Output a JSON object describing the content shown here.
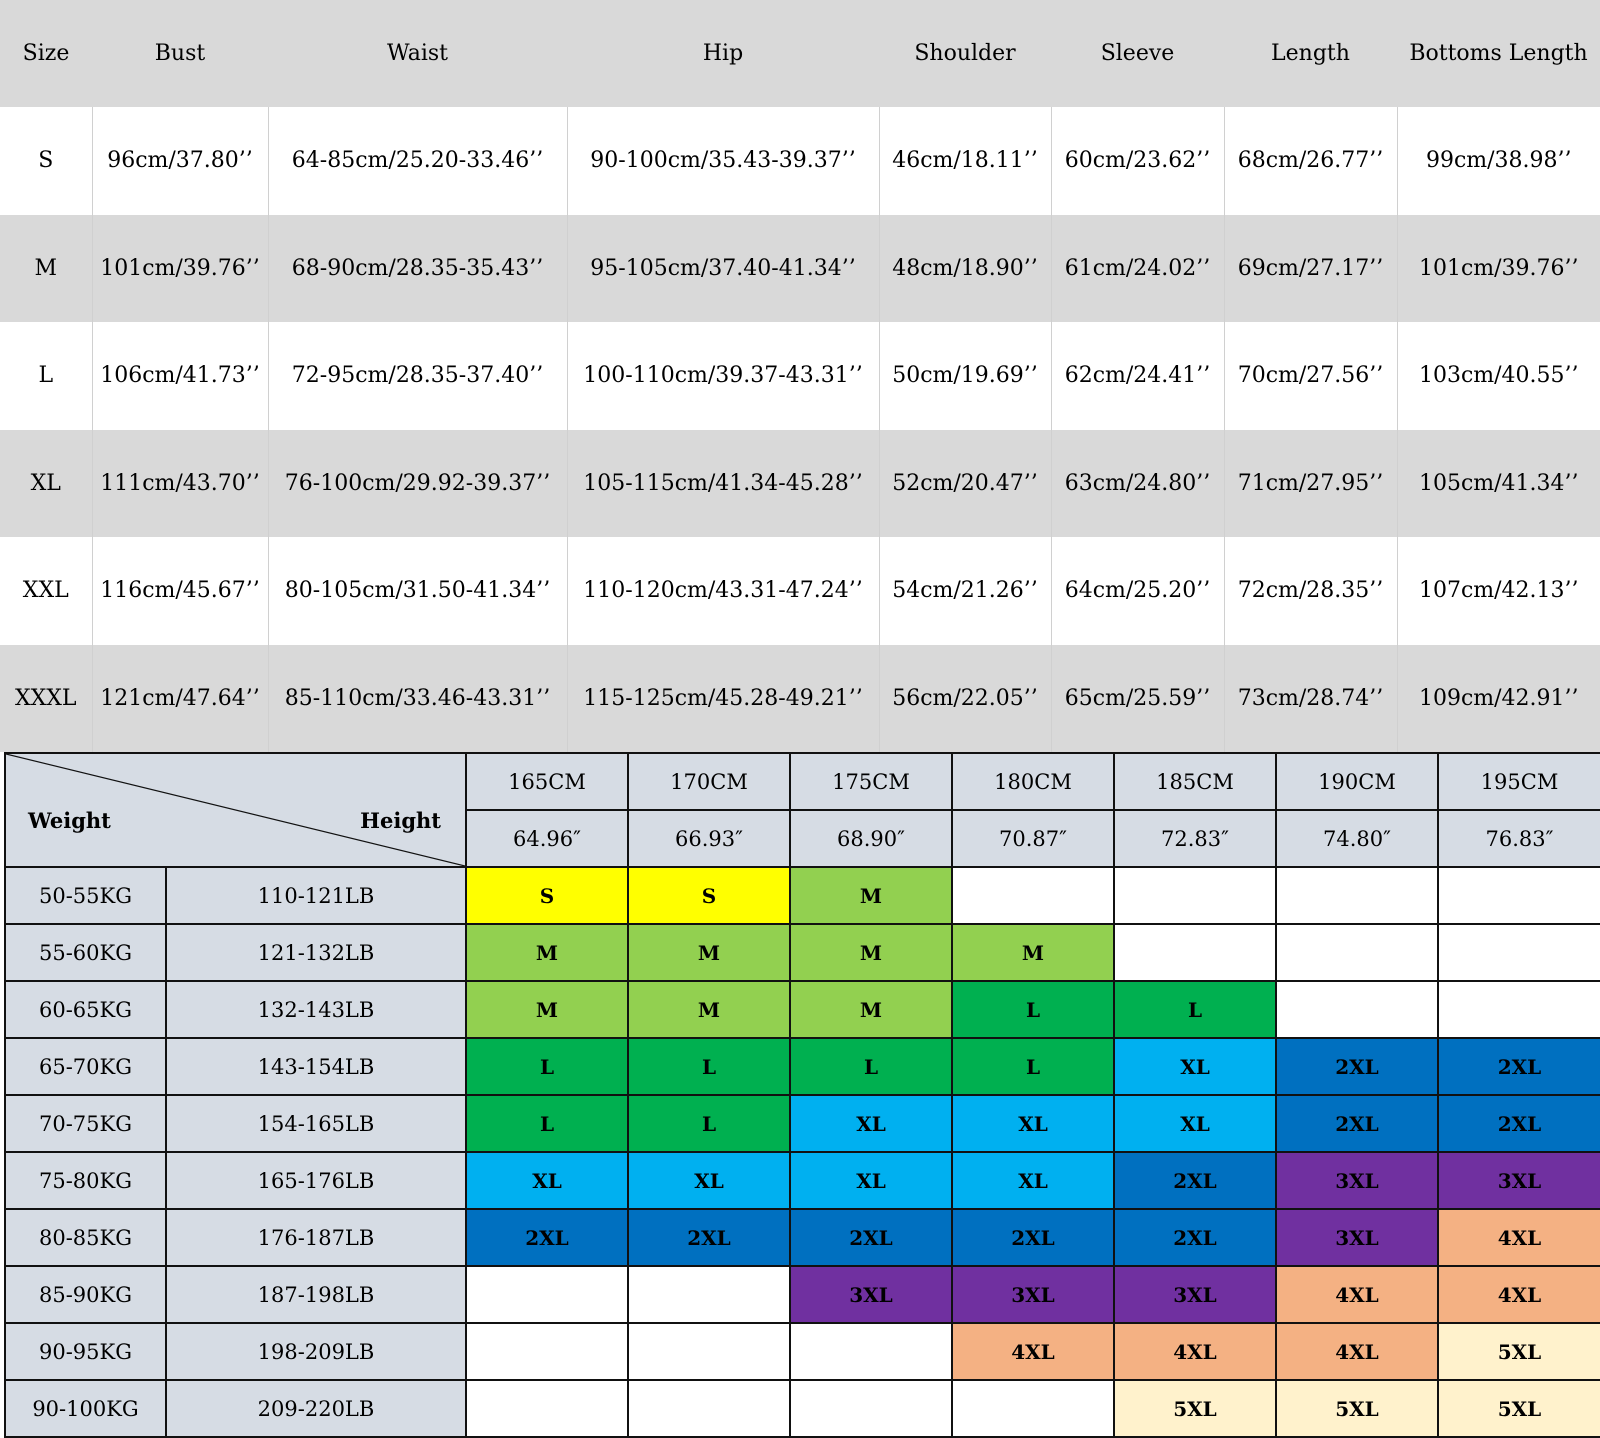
{
  "size_chart": {
    "headers": [
      "Size",
      "Bust",
      "Waist",
      "Hip",
      "Shoulder",
      "Sleeve",
      "Length",
      "Bottoms Length"
    ],
    "rows": [
      [
        "S",
        "96cm/37.80’’",
        "64-85cm/25.20-33.46’’",
        "90-100cm/35.43-39.37’’",
        "46cm/18.11’’",
        "60cm/23.62’’",
        "68cm/26.77’’",
        "99cm/38.98’’"
      ],
      [
        "M",
        "101cm/39.76’’",
        "68-90cm/28.35-35.43’’",
        "95-105cm/37.40-41.34’’",
        "48cm/18.90’’",
        "61cm/24.02’’",
        "69cm/27.17’’",
        "101cm/39.76’’"
      ],
      [
        "L",
        "106cm/41.73’’",
        "72-95cm/28.35-37.40’’",
        "100-110cm/39.37-43.31’’",
        "50cm/19.69’’",
        "62cm/24.41’’",
        "70cm/27.56’’",
        "103cm/40.55’’"
      ],
      [
        "XL",
        "111cm/43.70’’",
        "76-100cm/29.92-39.37’’",
        "105-115cm/41.34-45.28’’",
        "52cm/20.47’’",
        "63cm/24.80’’",
        "71cm/27.95’’",
        "105cm/41.34’’"
      ],
      [
        "XXL",
        "116cm/45.67’’",
        "80-105cm/31.50-41.34’’",
        "110-120cm/43.31-47.24’’",
        "54cm/21.26’’",
        "64cm/25.20’’",
        "72cm/28.35’’",
        "107cm/42.13’’"
      ],
      [
        "XXXL",
        "121cm/47.64’’",
        "85-110cm/33.46-43.31’’",
        "115-125cm/45.28-49.21’’",
        "56cm/22.05’’",
        "65cm/25.59’’",
        "73cm/28.74’’",
        "109cm/42.91’’"
      ]
    ]
  },
  "fit_chart": {
    "corner_left": "Weight",
    "corner_right": "Height",
    "heights_cm": [
      "165CM",
      "170CM",
      "175CM",
      "180CM",
      "185CM",
      "190CM",
      "195CM"
    ],
    "heights_in": [
      "64.96″",
      "66.93″",
      "68.90″",
      "70.87″",
      "72.83″",
      "74.80″",
      "76.83″"
    ],
    "colors": {
      "S": "#ffff00",
      "M": "#92d050",
      "L": "#00b050",
      "XL": "#00b0f0",
      "2XL": "#0070c0",
      "3XL": "#7030a0",
      "4XL": "#f4b183",
      "5XL": "#fff2cc",
      "empty": "#ffffff"
    },
    "rows": [
      {
        "kg": "50-55KG",
        "lb": "110-121LB",
        "sizes": [
          "S",
          "S",
          "M",
          "",
          "",
          "",
          ""
        ]
      },
      {
        "kg": "55-60KG",
        "lb": "121-132LB",
        "sizes": [
          "M",
          "M",
          "M",
          "M",
          "",
          "",
          ""
        ]
      },
      {
        "kg": "60-65KG",
        "lb": "132-143LB",
        "sizes": [
          "M",
          "M",
          "M",
          "L",
          "L",
          "",
          ""
        ]
      },
      {
        "kg": "65-70KG",
        "lb": "143-154LB",
        "sizes": [
          "L",
          "L",
          "L",
          "L",
          "XL",
          "2XL",
          "2XL"
        ]
      },
      {
        "kg": "70-75KG",
        "lb": "154-165LB",
        "sizes": [
          "L",
          "L",
          "XL",
          "XL",
          "XL",
          "2XL",
          "2XL"
        ]
      },
      {
        "kg": "75-80KG",
        "lb": "165-176LB",
        "sizes": [
          "XL",
          "XL",
          "XL",
          "XL",
          "2XL",
          "3XL",
          "3XL"
        ]
      },
      {
        "kg": "80-85KG",
        "lb": "176-187LB",
        "sizes": [
          "2XL",
          "2XL",
          "2XL",
          "2XL",
          "2XL",
          "3XL",
          "4XL"
        ]
      },
      {
        "kg": "85-90KG",
        "lb": "187-198LB",
        "sizes": [
          "",
          "",
          "3XL",
          "3XL",
          "3XL",
          "4XL",
          "4XL"
        ]
      },
      {
        "kg": "90-95KG",
        "lb": "198-209LB",
        "sizes": [
          "",
          "",
          "",
          "4XL",
          "4XL",
          "4XL",
          "5XL"
        ]
      },
      {
        "kg": "90-100KG",
        "lb": "209-220LB",
        "sizes": [
          "",
          "",
          "",
          "",
          "5XL",
          "5XL",
          "5XL"
        ]
      }
    ]
  }
}
